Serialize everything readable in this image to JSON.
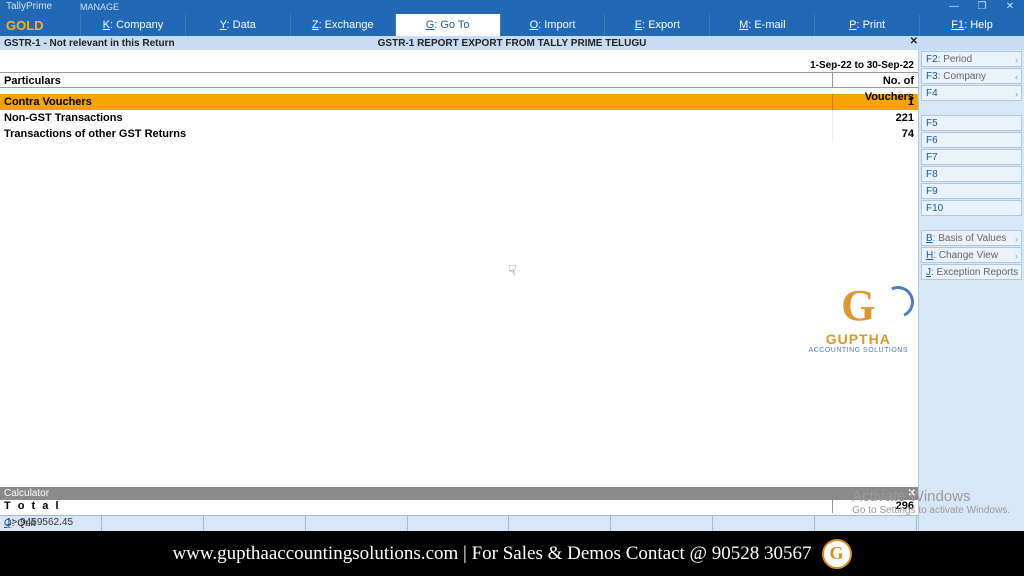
{
  "title": {
    "app": "TallyPrime",
    "manage": "MANAGE",
    "edition": "GOLD"
  },
  "window_controls": {
    "min": "—",
    "max": "❐",
    "close": "✕"
  },
  "menu": [
    {
      "key": "K",
      "label": ": Company"
    },
    {
      "key": "Y",
      "label": ": Data"
    },
    {
      "key": "Z",
      "label": ": Exchange"
    },
    {
      "key": "G",
      "label": ": Go To",
      "active": true
    },
    {
      "key": "O",
      "label": ": Import"
    },
    {
      "key": "E",
      "label": ": Export"
    },
    {
      "key": "M",
      "label": ": E-mail"
    },
    {
      "key": "P",
      "label": ": Print"
    },
    {
      "key": "F1",
      "label": ": Help"
    }
  ],
  "header": {
    "left": "GSTR-1  -  Not relevant in this Return",
    "center": "GSTR-1 REPORT EXPORT FROM TALLY PRIME TELUGU",
    "close": "✕"
  },
  "period": "1-Sep-22 to 30-Sep-22",
  "columns": {
    "particulars": "Particulars",
    "vouchers": "No. of Vouchers"
  },
  "rows": [
    {
      "label": "Contra Vouchers",
      "value": "1",
      "highlight": true
    },
    {
      "label": "Non-GST Transactions",
      "value": "221",
      "bold": true
    },
    {
      "label": "Transactions of other GST Returns",
      "value": "74",
      "bold": true
    }
  ],
  "total": {
    "label": "T o t a l",
    "value": "296"
  },
  "bottom_button": {
    "key": "Q",
    "label": ": Quit"
  },
  "calculator": {
    "title": "Calculator",
    "close": "✕",
    "line1": "1>  9459562.45"
  },
  "side_buttons_top": [
    {
      "key": "F2",
      "label": ": Period",
      "disabled": true,
      "arrow": "›"
    },
    {
      "key": "F3",
      "label": ": Company",
      "arrow": "‹"
    },
    {
      "key": "F4",
      "label": "",
      "disabled": true,
      "arrow": "›"
    }
  ],
  "side_buttons_mid": [
    {
      "key": "F5",
      "label": "",
      "disabled": true
    },
    {
      "key": "F6",
      "label": "",
      "disabled": true
    },
    {
      "key": "F7",
      "label": "",
      "disabled": true
    },
    {
      "key": "F8",
      "label": "",
      "disabled": true
    },
    {
      "key": "F9",
      "label": "",
      "disabled": true
    },
    {
      "key": "F10",
      "label": "",
      "disabled": true
    }
  ],
  "side_buttons_bot": [
    {
      "key": "B",
      "label": ": Basis of Values",
      "arrow": "›"
    },
    {
      "key": "H",
      "label": ": Change View",
      "arrow": "›"
    },
    {
      "key": "J",
      "label": ": Exception Reports",
      "arrow": "›"
    }
  ],
  "logo": {
    "g": "G",
    "name": "GUPTHA",
    "sub": "ACCOUNTING SOLUTIONS"
  },
  "activate": {
    "t1": "Activate Windows",
    "t2": "Go to Settings to activate Windows."
  },
  "footer": {
    "text": "www.gupthaaccountingsolutions.com | For Sales & Demos Contact @ 90528 30567",
    "badge": "G"
  }
}
